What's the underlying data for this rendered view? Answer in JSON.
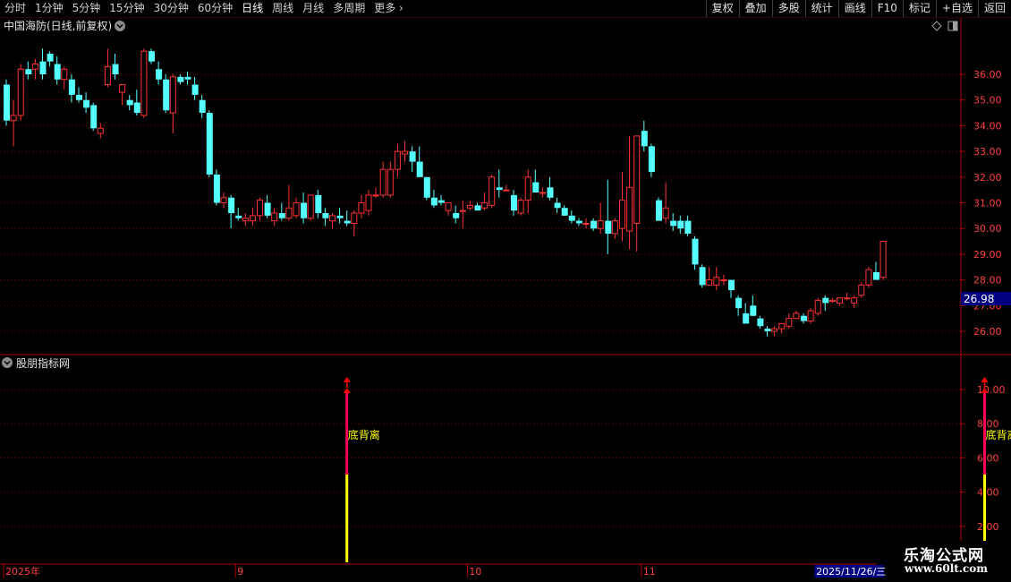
{
  "toolbar": {
    "periods": [
      "分时",
      "1分钟",
      "5分钟",
      "15分钟",
      "30分钟",
      "60分钟",
      "日线",
      "周线",
      "月线",
      "多周期",
      "更多"
    ],
    "active_period": "日线",
    "more_arrow": "›",
    "buttons": [
      "复权",
      "叠加",
      "多股",
      "统计",
      "画线",
      "F10",
      "标记",
      "+自选",
      "返回"
    ]
  },
  "main_panel": {
    "title": "中国海防(日线,前复权)",
    "price_ticks": [
      "36.00",
      "35.00",
      "34.00",
      "33.00",
      "32.00",
      "31.00",
      "30.00",
      "29.00",
      "28.00",
      "27.00",
      "26.00"
    ],
    "current_price": "26.98"
  },
  "indicator_panel": {
    "title": "股朋指标网",
    "ticks": [
      "10.00",
      "8.00",
      "6.00",
      "4.00",
      "2.00"
    ],
    "signal_label": "底背离",
    "signals": [
      {
        "date_index": 47,
        "value": 10
      },
      {
        "date_index": 135,
        "value": 10
      }
    ]
  },
  "date_axis": {
    "labels": [
      {
        "text": "2025年",
        "index": 0
      },
      {
        "text": "9",
        "index": 32
      },
      {
        "text": "10",
        "index": 64
      },
      {
        "text": "11",
        "index": 88
      },
      {
        "text": "2025/11/26/三",
        "index": 112,
        "highlight": true
      }
    ]
  },
  "colors": {
    "up": "#ff3232",
    "down": "#54ffff",
    "axis": "#b00000",
    "grid": "#8b0000",
    "signal_top": "#ff0055",
    "signal_bottom": "#ffff00",
    "price_tag_bg": "#000080"
  },
  "logo": {
    "name": "乐淘公式网",
    "url": "www.60lt.com"
  },
  "chart_data": {
    "type": "candlestick",
    "title": "中国海防(日线,前复权)",
    "ylim": [
      25.5,
      37
    ],
    "ohlc": [
      [
        35.6,
        35.8,
        34.0,
        34.2
      ],
      [
        34.2,
        35.0,
        33.2,
        34.4
      ],
      [
        34.4,
        36.4,
        34.2,
        36.2
      ],
      [
        36.2,
        36.5,
        35.8,
        36.0
      ],
      [
        36.2,
        36.6,
        35.8,
        36.4
      ],
      [
        36.5,
        37.0,
        35.8,
        36.0
      ],
      [
        36.8,
        36.9,
        36.3,
        36.5
      ],
      [
        36.4,
        36.7,
        35.6,
        35.8
      ],
      [
        35.8,
        36.3,
        35.4,
        36.2
      ],
      [
        35.8,
        36.0,
        34.9,
        35.2
      ],
      [
        35.2,
        35.5,
        34.9,
        35.0
      ],
      [
        35.0,
        35.3,
        34.5,
        34.7
      ],
      [
        34.8,
        34.9,
        33.8,
        33.9
      ],
      [
        33.7,
        34.1,
        33.5,
        33.9
      ],
      [
        35.6,
        37.0,
        35.5,
        36.3
      ],
      [
        36.4,
        36.8,
        35.8,
        36.0
      ],
      [
        35.3,
        35.6,
        34.8,
        35.6
      ],
      [
        35.0,
        35.2,
        34.6,
        34.8
      ],
      [
        34.9,
        35.4,
        34.4,
        34.5
      ],
      [
        34.4,
        37.0,
        34.3,
        36.9
      ],
      [
        36.9,
        37.0,
        36.4,
        36.5
      ],
      [
        36.2,
        36.5,
        35.6,
        35.8
      ],
      [
        35.8,
        36.0,
        34.5,
        34.6
      ],
      [
        34.5,
        36.0,
        33.7,
        35.9
      ],
      [
        35.9,
        36.0,
        35.6,
        35.7
      ],
      [
        35.9,
        36.1,
        35.6,
        35.8
      ],
      [
        35.6,
        35.9,
        35.0,
        35.2
      ],
      [
        35.0,
        35.2,
        34.3,
        34.5
      ],
      [
        34.5,
        34.6,
        32.0,
        32.1
      ],
      [
        32.1,
        32.3,
        30.9,
        31.0
      ],
      [
        31.0,
        31.4,
        30.8,
        31.2
      ],
      [
        31.2,
        31.3,
        30.0,
        30.6
      ],
      [
        30.5,
        30.8,
        30.3,
        30.4
      ],
      [
        30.3,
        30.6,
        30.1,
        30.4
      ],
      [
        30.3,
        30.8,
        30.1,
        30.5
      ],
      [
        30.5,
        31.2,
        30.3,
        31.1
      ],
      [
        31.0,
        31.3,
        30.4,
        30.5
      ],
      [
        30.3,
        30.8,
        30.1,
        30.6
      ],
      [
        30.6,
        31.0,
        30.3,
        30.4
      ],
      [
        30.4,
        31.7,
        30.3,
        30.8
      ],
      [
        30.5,
        31.2,
        30.4,
        31.0
      ],
      [
        31.0,
        31.4,
        30.2,
        30.4
      ],
      [
        30.4,
        31.3,
        30.3,
        31.3
      ],
      [
        31.3,
        31.5,
        30.4,
        30.6
      ],
      [
        30.6,
        30.8,
        30.1,
        30.4
      ],
      [
        30.3,
        30.6,
        30.0,
        30.5
      ],
      [
        30.5,
        30.8,
        30.2,
        30.4
      ],
      [
        30.3,
        30.7,
        30.1,
        30.2
      ],
      [
        30.2,
        30.7,
        29.7,
        30.6
      ],
      [
        30.6,
        31.3,
        30.4,
        31.0
      ],
      [
        30.7,
        31.5,
        30.5,
        31.3
      ],
      [
        31.3,
        31.6,
        31.2,
        31.3
      ],
      [
        31.3,
        32.6,
        31.2,
        32.3
      ],
      [
        31.3,
        32.6,
        31.2,
        32.3
      ],
      [
        32.3,
        33.3,
        32.0,
        33.0
      ],
      [
        32.9,
        33.4,
        32.6,
        33.0
      ],
      [
        33.0,
        33.2,
        32.2,
        32.6
      ],
      [
        32.6,
        33.2,
        32.4,
        32.0
      ],
      [
        32.0,
        32.0,
        31.1,
        31.2
      ],
      [
        31.2,
        31.5,
        30.8,
        30.9
      ],
      [
        31.1,
        31.3,
        30.9,
        31.0
      ],
      [
        30.7,
        31.0,
        30.5,
        31.0
      ],
      [
        30.6,
        30.9,
        30.2,
        30.4
      ],
      [
        30.7,
        31.1,
        30.0,
        30.7
      ],
      [
        30.8,
        31.1,
        30.7,
        30.9
      ],
      [
        30.9,
        31.0,
        30.8,
        30.7
      ],
      [
        30.8,
        31.4,
        30.7,
        31.0
      ],
      [
        30.9,
        32.1,
        30.8,
        32.0
      ],
      [
        31.6,
        32.3,
        31.2,
        31.5
      ],
      [
        31.5,
        31.7,
        31.5,
        31.5
      ],
      [
        31.3,
        31.5,
        30.5,
        30.7
      ],
      [
        30.6,
        31.2,
        30.5,
        31.1
      ],
      [
        31.1,
        32.3,
        30.6,
        32.0
      ],
      [
        31.8,
        32.3,
        31.4,
        31.4
      ],
      [
        31.4,
        31.6,
        31.2,
        31.4
      ],
      [
        31.6,
        32.0,
        31.1,
        31.2
      ],
      [
        31.0,
        31.2,
        30.6,
        30.8
      ],
      [
        30.8,
        30.9,
        30.5,
        30.5
      ],
      [
        30.5,
        30.7,
        30.2,
        30.3
      ],
      [
        30.3,
        30.4,
        30.1,
        30.2
      ],
      [
        30.2,
        30.4,
        30.0,
        30.2
      ],
      [
        30.3,
        30.4,
        29.9,
        30.0
      ],
      [
        30.0,
        31.0,
        29.8,
        30.3
      ],
      [
        30.3,
        31.9,
        29.0,
        29.8
      ],
      [
        29.8,
        30.4,
        29.6,
        30.3
      ],
      [
        30.0,
        32.2,
        29.5,
        31.1
      ],
      [
        29.9,
        33.6,
        29.2,
        31.6
      ],
      [
        30.2,
        33.6,
        29.1,
        33.6
      ],
      [
        33.8,
        34.2,
        33.0,
        33.2
      ],
      [
        33.2,
        33.3,
        32.0,
        32.2
      ],
      [
        31.1,
        31.2,
        30.3,
        30.3
      ],
      [
        30.4,
        31.8,
        30.2,
        30.8
      ],
      [
        30.3,
        30.6,
        29.9,
        30.1
      ],
      [
        30.3,
        30.5,
        29.8,
        30.0
      ],
      [
        30.3,
        30.5,
        29.7,
        29.8
      ],
      [
        29.6,
        29.7,
        28.4,
        28.6
      ],
      [
        28.5,
        28.6,
        27.7,
        27.8
      ],
      [
        27.8,
        28.5,
        27.9,
        28.0
      ],
      [
        27.8,
        28.5,
        27.6,
        28.1
      ],
      [
        28.0,
        28.2,
        27.8,
        28.0
      ],
      [
        28.0,
        28.0,
        27.3,
        27.6
      ],
      [
        27.3,
        27.4,
        26.6,
        26.9
      ],
      [
        26.7,
        27.1,
        26.3,
        26.3
      ],
      [
        27.0,
        27.4,
        26.6,
        26.6
      ],
      [
        26.5,
        26.6,
        26.1,
        26.2
      ],
      [
        26.1,
        26.2,
        25.8,
        26.0
      ],
      [
        26.0,
        26.2,
        25.8,
        26.1
      ],
      [
        26.1,
        26.3,
        25.9,
        26.3
      ],
      [
        26.2,
        26.7,
        26.1,
        26.5
      ],
      [
        26.5,
        26.8,
        26.5,
        26.7
      ],
      [
        26.6,
        26.7,
        26.3,
        26.4
      ],
      [
        26.4,
        26.9,
        26.3,
        26.8
      ],
      [
        26.7,
        27.3,
        26.6,
        27.2
      ],
      [
        27.3,
        27.4,
        26.8,
        27.1
      ],
      [
        27.2,
        27.3,
        27.1,
        27.2
      ],
      [
        27.1,
        27.3,
        27.0,
        27.3
      ],
      [
        27.3,
        27.5,
        27.2,
        27.3
      ],
      [
        27.1,
        27.4,
        26.9,
        27.3
      ],
      [
        27.4,
        27.9,
        27.3,
        27.8
      ],
      [
        27.8,
        28.5,
        27.7,
        28.4
      ],
      [
        28.3,
        28.7,
        28.1,
        28.0
      ],
      [
        28.1,
        29.5,
        28.0,
        29.5
      ]
    ]
  }
}
